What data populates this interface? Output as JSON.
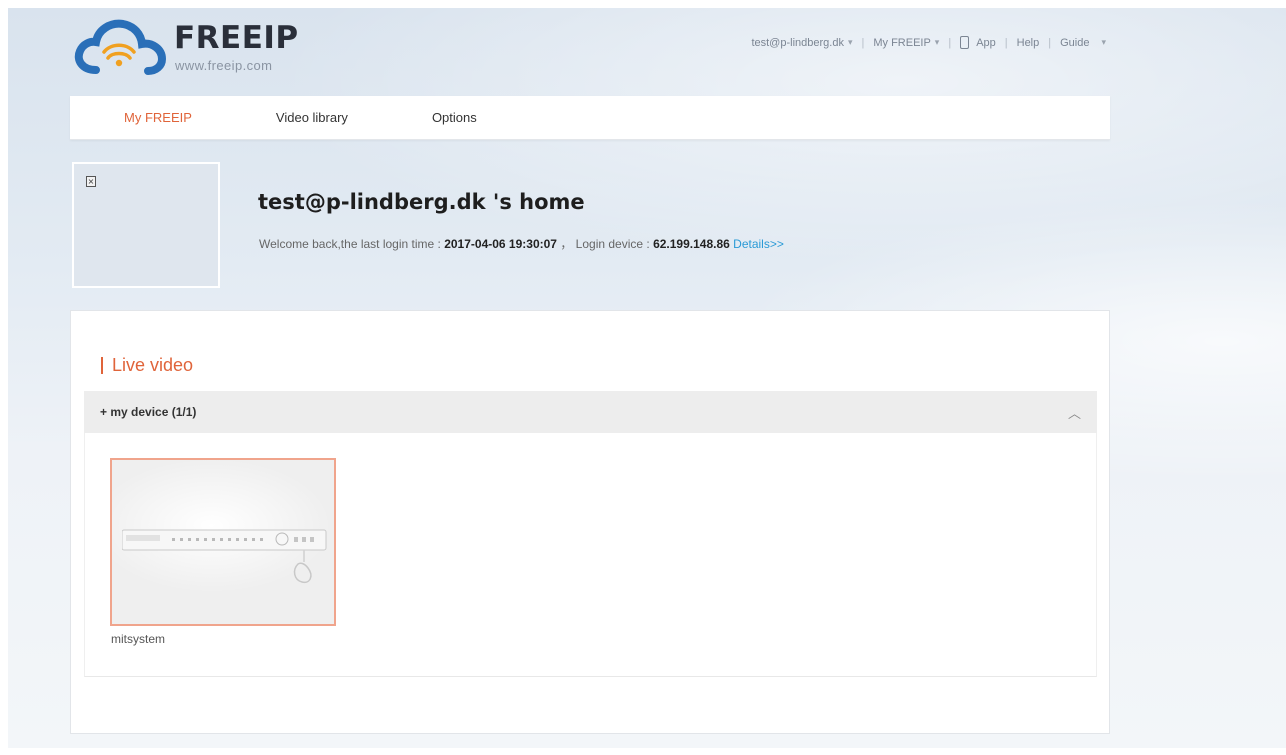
{
  "brand": {
    "title": "FREEIP",
    "subtitle": "www.freeip.com",
    "colors": {
      "accent": "#e0643a",
      "cloud_blue": "#2a6fb8",
      "wifi_orange": "#f0a020"
    }
  },
  "topnav": {
    "account": "test@p-lindberg.dk",
    "my_freeip": "My FREEIP",
    "app": "App",
    "help": "Help",
    "guide": "Guide",
    "account_icon": "chevron-down-icon",
    "app_icon": "phone-icon"
  },
  "navbar": {
    "tabs": [
      {
        "label": "My FREEIP",
        "active": true
      },
      {
        "label": "Video library",
        "active": false
      },
      {
        "label": "Options",
        "active": false
      }
    ]
  },
  "profile": {
    "home_title": "test@p-lindberg.dk 's home",
    "welcome_prefix": "Welcome back,the last login time :",
    "last_login": "2017-04-06 19:30:07",
    "separator": "，",
    "login_device_label": "Login device :",
    "login_device": "62.199.148.86",
    "details_link": "Details>>"
  },
  "live": {
    "section_title": "Live video",
    "group_label": "+ my device (1/1)",
    "devices": [
      {
        "name": "mitsystem"
      }
    ]
  }
}
